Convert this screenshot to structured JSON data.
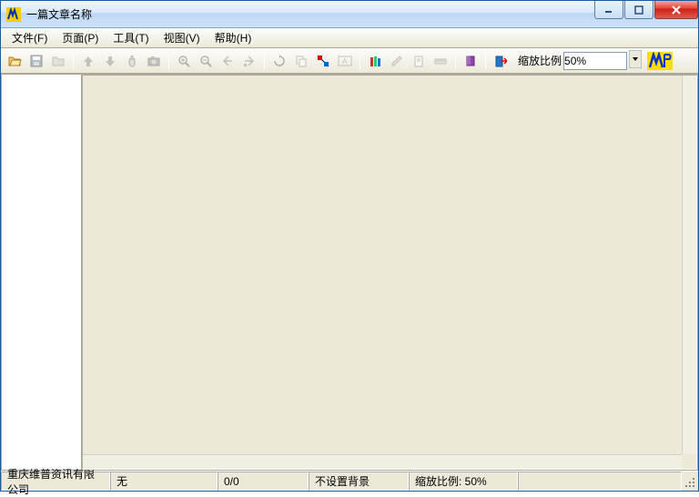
{
  "window": {
    "title": "一篇文章名称"
  },
  "menu": {
    "file": "文件(F)",
    "page": "页面(P)",
    "tools": "工具(T)",
    "view": "视图(V)",
    "help": "帮助(H)"
  },
  "toolbar": {
    "zoom_label": "缩放比例",
    "zoom_value": "50%"
  },
  "status": {
    "company": "重庆维普资讯有限公司",
    "none": "无",
    "page": "0/0",
    "background": "不设置背景",
    "zoom": "缩放比例:  50%"
  },
  "colors": {
    "accent": "#316ac5",
    "border": "#aca899",
    "chrome": "#ece9d8"
  }
}
